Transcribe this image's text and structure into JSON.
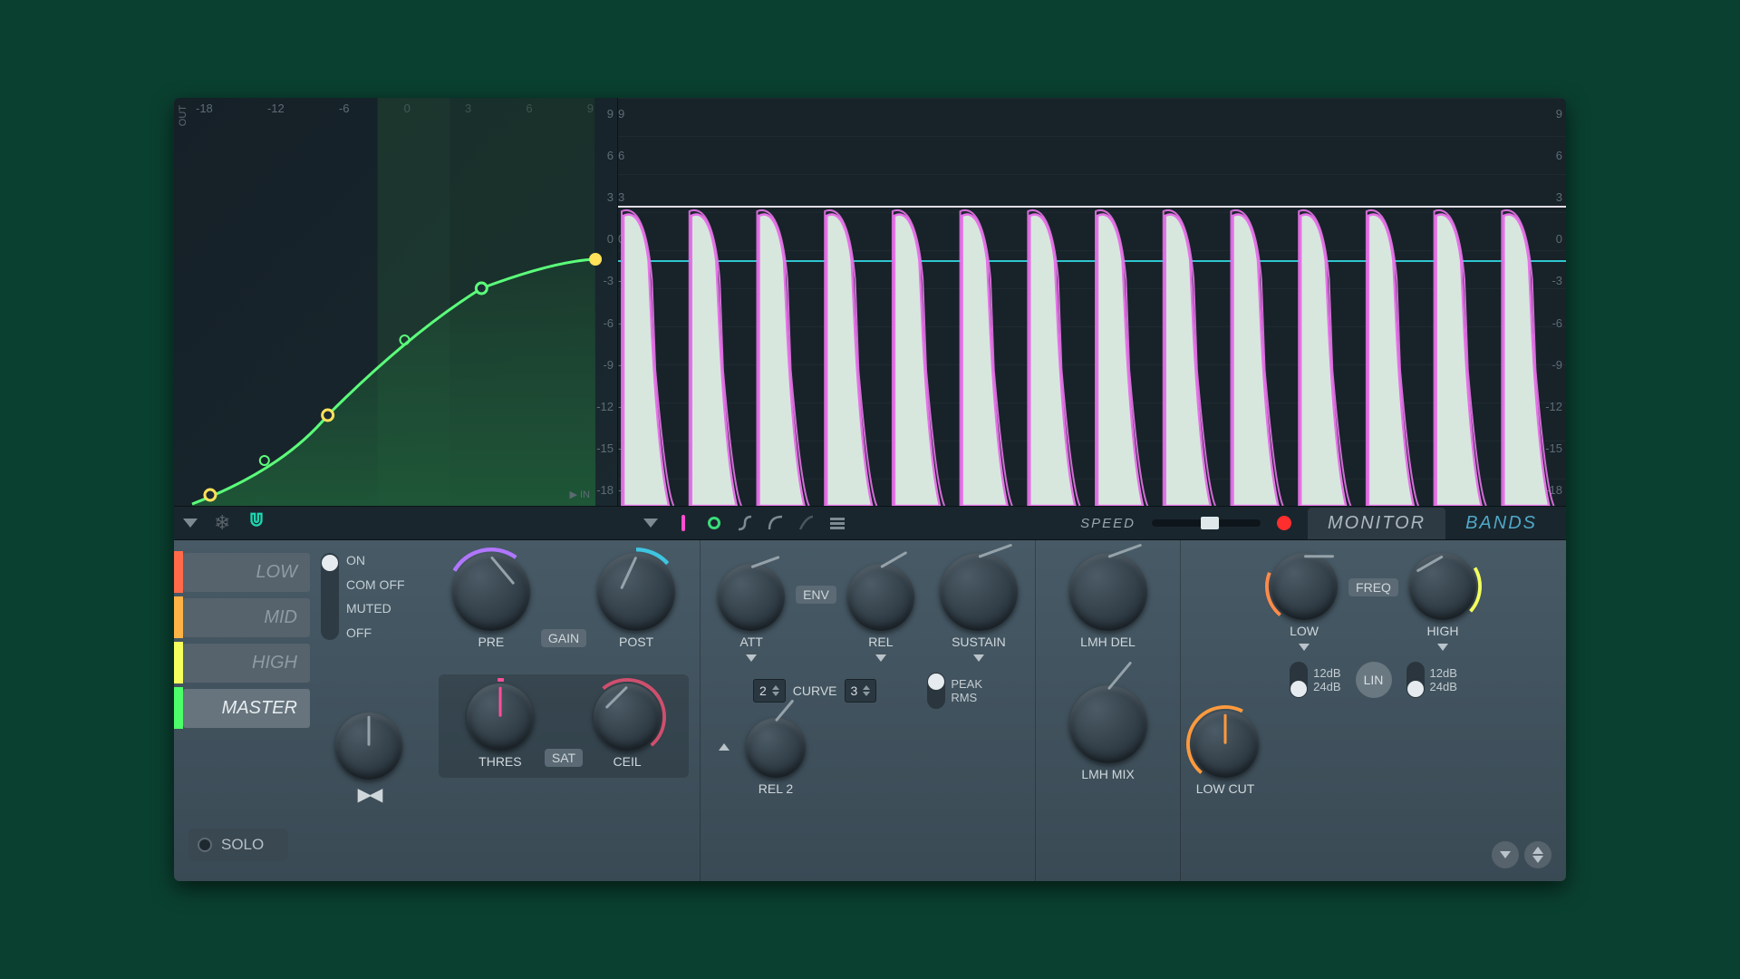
{
  "curve": {
    "out_label": "OUT",
    "in_label": "▶ IN",
    "x_ticks": [
      "-18",
      "-12",
      "-6",
      "0",
      "3",
      "6",
      "9"
    ],
    "y_ticks": [
      "9",
      "6",
      "3",
      "0",
      "-3",
      "-6",
      "-9",
      "-12",
      "-15",
      "-18"
    ]
  },
  "wave": {
    "y_ticks": [
      "9",
      "6",
      "3",
      "0",
      "-3",
      "-6",
      "-9",
      "-12",
      "-15",
      "-18"
    ]
  },
  "toolbar": {
    "speed_label": "SPEED",
    "monitor_tab": "MONITOR",
    "bands_tab": "BANDS"
  },
  "bands": {
    "items": [
      {
        "label": "LOW",
        "color": "#ff6a4a"
      },
      {
        "label": "MID",
        "color": "#ffb347"
      },
      {
        "label": "HIGH",
        "color": "#f4ff5e"
      },
      {
        "label": "MASTER",
        "color": "#4cff6a"
      }
    ],
    "solo_label": "SOLO"
  },
  "state_switch": {
    "options": [
      "ON",
      "COM OFF",
      "MUTED",
      "OFF"
    ],
    "selected_index": 0
  },
  "knobs": {
    "pre": {
      "label": "PRE",
      "angle": -40,
      "arc_color": "#b176ff"
    },
    "gain": {
      "label": "GAIN"
    },
    "post": {
      "label": "POST",
      "angle": 25,
      "arc_color": "#3ec5e0"
    },
    "thres": {
      "label": "THRES",
      "angle": 0,
      "arc_color": "#ff4f9b"
    },
    "sat": {
      "label": "SAT"
    },
    "ceil": {
      "label": "CEIL",
      "angle": 45,
      "arc_color": "#d04f6e"
    },
    "att": {
      "label": "ATT",
      "angle": -110
    },
    "env": {
      "label": "ENV"
    },
    "rel": {
      "label": "REL",
      "angle": -120
    },
    "sustain": {
      "label": "SUSTAIN",
      "angle": -110
    },
    "rel2": {
      "label": "REL 2",
      "angle": -140
    },
    "lmh_del": {
      "label": "LMH DEL",
      "angle": -110
    },
    "lmh_mix": {
      "label": "LMH MIX",
      "angle": -140
    },
    "low": {
      "label": "LOW",
      "angle": -90,
      "arc_color": "#ff8a4a"
    },
    "freq": {
      "label": "FREQ"
    },
    "high": {
      "label": "HIGH",
      "angle": 60,
      "arc_color": "#f4ff5e"
    },
    "lowcut": {
      "label": "LOW CUT",
      "angle": 0,
      "arc_color": "#ff9a3d"
    },
    "stereo": {
      "angle": 0
    }
  },
  "curves": {
    "label": "CURVE",
    "att_value": "2",
    "rel_value": "3"
  },
  "peak_switch": {
    "opt1": "PEAK",
    "opt2": "RMS"
  },
  "slope_low": {
    "opt1": "12dB",
    "opt2": "24dB"
  },
  "slope_high": {
    "opt1": "12dB",
    "opt2": "24dB"
  },
  "lin_button": {
    "label": "LIN"
  },
  "colors": {
    "waveform_fill": "#d7e7de",
    "waveform_outline": "#e573e7",
    "envelope_line": "#f4f0f6",
    "zero_line": "#2fc6d0",
    "curve_line": "#5bff7a",
    "curve_fill": "#2a7a4a"
  }
}
